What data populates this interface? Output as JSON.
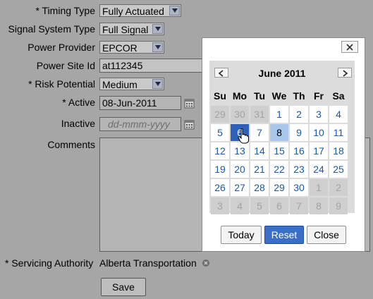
{
  "form": {
    "timing_type": {
      "label": "* Timing Type",
      "value": "Fully Actuated"
    },
    "signal_system_type": {
      "label": "Signal System Type",
      "value": "Full Signal"
    },
    "power_provider": {
      "label": "Power Provider",
      "value": "EPCOR"
    },
    "power_site_id": {
      "label": "Power Site Id",
      "value": "at112345"
    },
    "risk_potential": {
      "label": "* Risk Potential",
      "value": "Medium"
    },
    "active": {
      "label": "* Active",
      "value": "08-Jun-2011"
    },
    "inactive": {
      "label": "Inactive",
      "placeholder": "dd-mmm-yyyy"
    },
    "comments": {
      "label": "Comments",
      "value": ""
    },
    "servicing_authority": {
      "label": "* Servicing Authority",
      "value": "Alberta Transportation"
    },
    "save_label": "Save"
  },
  "datepicker": {
    "close_label": "×",
    "month_title": "June 2011",
    "prev_label": "‹",
    "next_label": "›",
    "weekdays": [
      "Su",
      "Mo",
      "Tu",
      "We",
      "Th",
      "Fr",
      "Sa"
    ],
    "weeks": [
      [
        {
          "d": "29",
          "o": true
        },
        {
          "d": "30",
          "o": true
        },
        {
          "d": "31",
          "o": true
        },
        {
          "d": "1"
        },
        {
          "d": "2"
        },
        {
          "d": "3"
        },
        {
          "d": "4"
        }
      ],
      [
        {
          "d": "5"
        },
        {
          "d": "6",
          "sel": true
        },
        {
          "d": "7"
        },
        {
          "d": "8",
          "today": true
        },
        {
          "d": "9"
        },
        {
          "d": "10"
        },
        {
          "d": "11"
        }
      ],
      [
        {
          "d": "12"
        },
        {
          "d": "13"
        },
        {
          "d": "14"
        },
        {
          "d": "15"
        },
        {
          "d": "16"
        },
        {
          "d": "17"
        },
        {
          "d": "18"
        }
      ],
      [
        {
          "d": "19"
        },
        {
          "d": "20"
        },
        {
          "d": "21"
        },
        {
          "d": "22"
        },
        {
          "d": "23"
        },
        {
          "d": "24"
        },
        {
          "d": "25"
        }
      ],
      [
        {
          "d": "26"
        },
        {
          "d": "27"
        },
        {
          "d": "28"
        },
        {
          "d": "29"
        },
        {
          "d": "30"
        },
        {
          "d": "1",
          "o": true
        },
        {
          "d": "2",
          "o": true
        }
      ],
      [
        {
          "d": "3",
          "o": true
        },
        {
          "d": "4",
          "o": true
        },
        {
          "d": "5",
          "o": true
        },
        {
          "d": "6",
          "o": true
        },
        {
          "d": "7",
          "o": true
        },
        {
          "d": "8",
          "o": true
        },
        {
          "d": "9",
          "o": true
        }
      ]
    ],
    "today_label": "Today",
    "reset_label": "Reset",
    "close_button_label": "Close"
  },
  "colors": {
    "overlay": "#a6a6a6",
    "selected_day": "#2d62b8",
    "today_day": "#a9c7ec",
    "link": "#1a5aa6"
  },
  "icons": [
    "chevron-down-icon",
    "calendar-icon",
    "close-icon",
    "clear-icon",
    "cursor-hand-icon"
  ]
}
